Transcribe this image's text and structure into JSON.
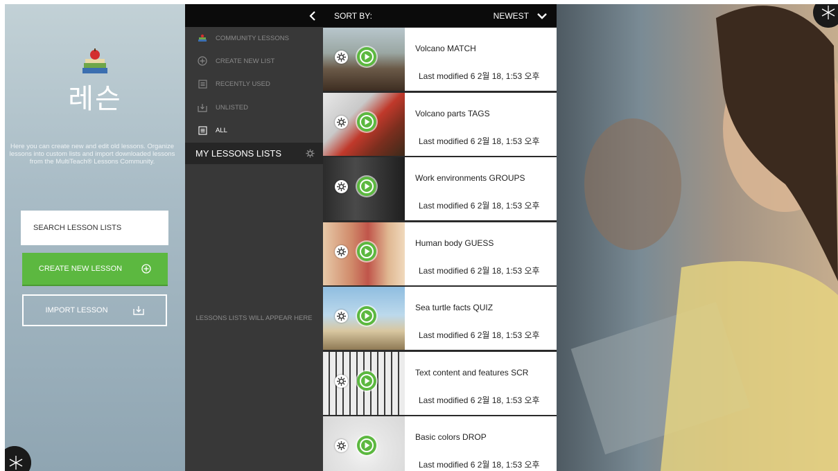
{
  "app": {
    "title": "레슨",
    "description": "Here you can create new and edit old lessons. Organize lessons into custom lists and import downloaded lessons from the MultiTeach® Lessons Community."
  },
  "left_panel": {
    "search_label": "SEARCH LESSON LISTS",
    "create_label": "CREATE NEW LESSON",
    "import_label": "IMPORT LESSON"
  },
  "nav": {
    "items": [
      {
        "label": "COMMUNITY LESSONS",
        "icon": "books-icon"
      },
      {
        "label": "CREATE NEW LIST",
        "icon": "plus-circle-icon"
      },
      {
        "label": "RECENTLY USED",
        "icon": "list-icon"
      },
      {
        "label": "UNLISTED",
        "icon": "tray-icon"
      },
      {
        "label": "ALL",
        "icon": "list-icon"
      }
    ],
    "my_lists_label": "MY LESSONS LISTS",
    "empty_message": "LESSONS LISTS WILL APPEAR HERE"
  },
  "sort": {
    "label": "SORT BY:",
    "value": "NEWEST"
  },
  "lessons": [
    {
      "title": "Volcano MATCH",
      "date": "Last modified 6 2월 18, 1:53 오후"
    },
    {
      "title": "Volcano parts TAGS",
      "date": "Last modified 6 2월 18, 1:53 오후"
    },
    {
      "title": "Work environments GROUPS",
      "date": "Last modified 6 2월 18, 1:53 오후"
    },
    {
      "title": "Human body GUESS",
      "date": "Last modified 6 2월 18, 1:53 오후"
    },
    {
      "title": "Sea turtle facts QUIZ",
      "date": "Last modified 6 2월 18, 1:53 오후"
    },
    {
      "title": "Text content and features SCR",
      "date": "Last modified 6 2월 18, 1:53 오후"
    },
    {
      "title": "Basic colors DROP",
      "date": "Last modified 6 2월 18, 1:53 오후"
    }
  ],
  "colors": {
    "accent_green": "#5cb840",
    "nav_bg": "#383838",
    "bar_bg": "#0b0b0b"
  }
}
